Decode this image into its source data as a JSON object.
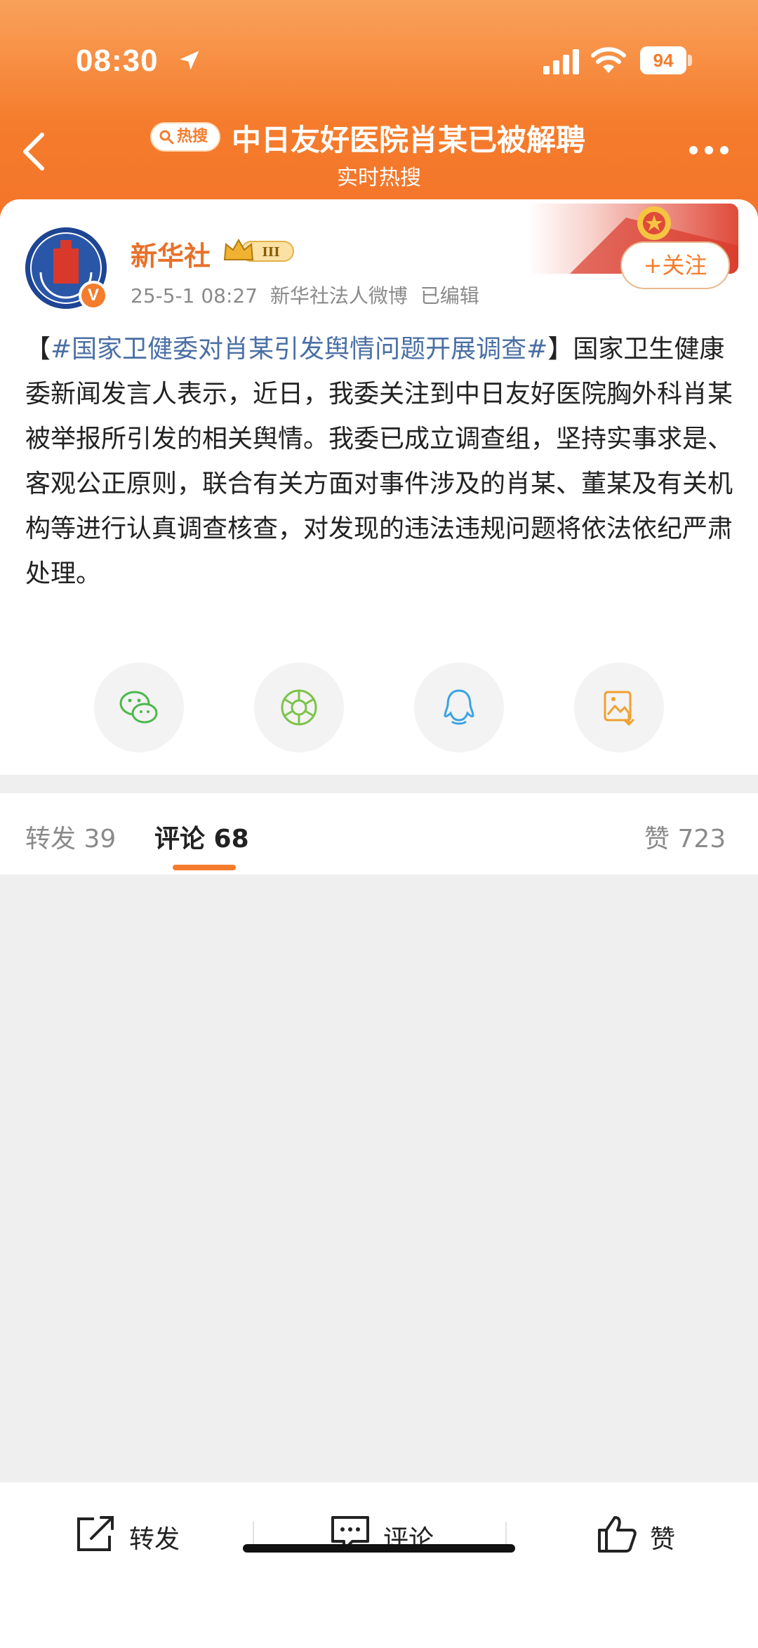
{
  "status_bar": {
    "time": "08:30",
    "battery": "94"
  },
  "nav": {
    "hot_badge": "热搜",
    "title": "中日友好医院肖某已被解聘",
    "subtitle": "实时热搜"
  },
  "post": {
    "username": "新华社",
    "level": "III",
    "verified_mark": "V",
    "timestamp": "25-5-1 08:27",
    "source": "新华社法人微博",
    "edited": "已编辑",
    "follow_label": "+关注",
    "hashtag": "#国家卫健委对肖某引发舆情问题开展调查#",
    "body_line1_rest": "国家卫",
    "body": "生健康委新闻发言人表示，近日，我委关注到中日友好医院胸外科肖某被举报所引发的相关舆情。我委已成立调查组，坚持实事求是、客观公正原则，联合有关方面对事件涉及的肖某、董某及有关机构等进行认真调查核查，对发现的违法违规问题将依法依纪严肃处理。",
    "share_icons": [
      "wechat-icon",
      "moments-icon",
      "qq-icon",
      "save-image-icon"
    ]
  },
  "tabs": {
    "repost": "转发 39",
    "comments": "评论 68",
    "likes": "赞 723"
  },
  "bottom_bar": {
    "repost": "转发",
    "comment": "评论",
    "like": "赞"
  },
  "colors": {
    "accent": "#f57c2c",
    "hashtag": "#4a6fa5"
  }
}
